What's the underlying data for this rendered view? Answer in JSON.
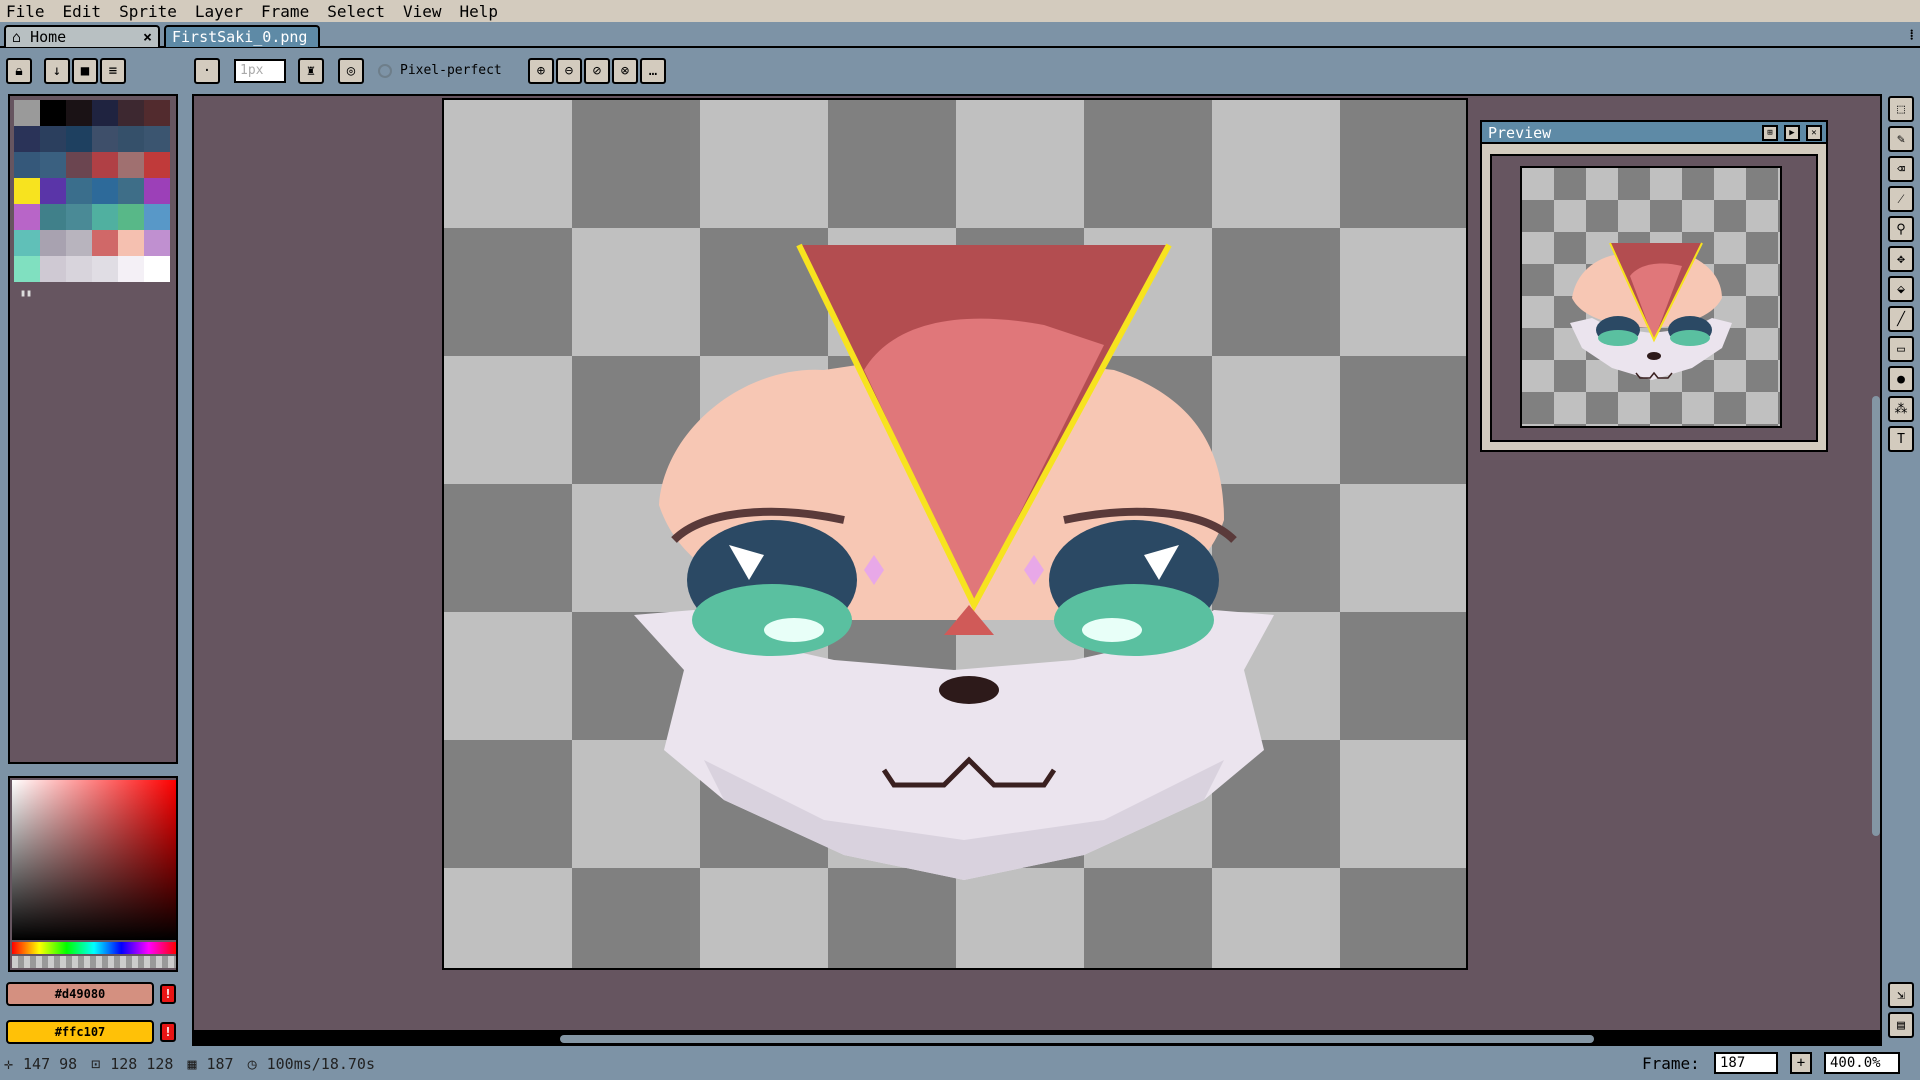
{
  "menu": [
    "File",
    "Edit",
    "Sprite",
    "Layer",
    "Frame",
    "Select",
    "View",
    "Help"
  ],
  "tabs": {
    "home": "Home",
    "file": "FirstSaki_0.png"
  },
  "toolbar": {
    "brush_size": "1px",
    "pixel_perfect": "Pixel-perfect"
  },
  "palette": [
    "#9a9a9a",
    "#000000",
    "#1a1215",
    "#1f2340",
    "#3d2830",
    "#522b2e",
    "#2a3358",
    "#2b3f5e",
    "#1e4060",
    "#3e4f6a",
    "#35506a",
    "#3b5570",
    "#35587a",
    "#3a6080",
    "#6b4550",
    "#b04045",
    "#a07070",
    "#c03a3a",
    "#f7e31f",
    "#5a35a8",
    "#3a6e8c",
    "#2d6a9a",
    "#3e6e88",
    "#9c40b8",
    "#b865c8",
    "#40808a",
    "#4a8a96",
    "#50b0a0",
    "#58b888",
    "#5898c8",
    "#60c0b8",
    "#a8a2b0",
    "#b8b4be",
    "#d06868",
    "#f5c0b0",
    "#c090d0",
    "#80e0c0",
    "#cfc9d3",
    "#d8d4dc",
    "#e0dde4",
    "#f4f0f6",
    "#ffffff"
  ],
  "colors": {
    "foreground": "#d49080",
    "background": "#ffc107"
  },
  "preview": {
    "title": "Preview"
  },
  "status": {
    "cursor": "147  98",
    "size": "128  128",
    "frame_count": "187",
    "duration": "100ms/18.70s",
    "frame_label": "Frame:",
    "frame_value": "187",
    "zoom": "400.0%"
  }
}
